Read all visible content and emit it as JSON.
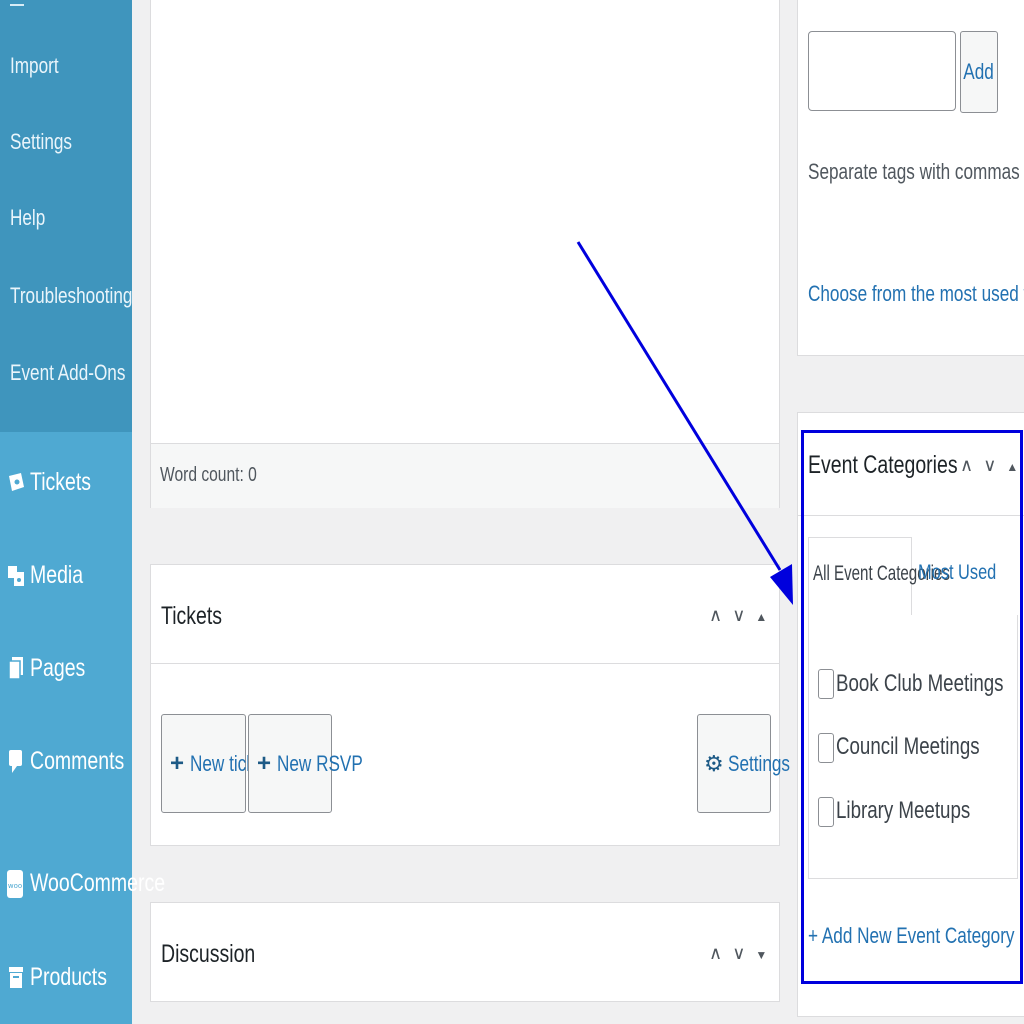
{
  "sidebar": {
    "sub_items": [
      "Import",
      "Settings",
      "Help",
      "Troubleshooting",
      "Event Add-Ons"
    ],
    "main_items": [
      "Tickets",
      "Media",
      "Pages",
      "Comments",
      "WooCommerce",
      "Products"
    ]
  },
  "editor": {
    "word_count": "Word count: 0"
  },
  "tickets_panel": {
    "title": "Tickets",
    "new_ticket": "New ticket",
    "new_rsvp": "New RSVP",
    "settings": "Settings"
  },
  "discussion_panel": {
    "title": "Discussion"
  },
  "tags_panel": {
    "add_button": "Add",
    "input_value": "",
    "hint": "Separate tags with commas",
    "most_used_link": "Choose from the most used tags"
  },
  "categories_panel": {
    "title": "Event Categories",
    "tab_all": "All Event Categories",
    "tab_most_used": "Most Used",
    "items": [
      "Book Club Meetings",
      "Council Meetings",
      "Library Meetups"
    ],
    "add_new": "+ Add New Event Category"
  },
  "colors": {
    "sidebar": "#4fa9d2",
    "sidebar_sub": "#3f95bd",
    "annotation": "#0000dd",
    "link": "#2271b1"
  }
}
